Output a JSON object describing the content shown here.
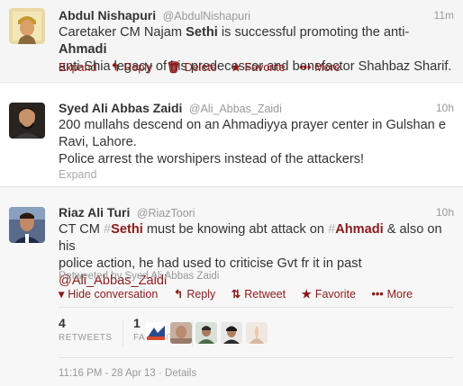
{
  "tweets": [
    {
      "fullname": "Abdul Nishapuri",
      "handle": "@AbdulNishapuri",
      "time": "11m",
      "text_a": "Caretaker CM Najam ",
      "text_kw1": "Sethi",
      "text_b": " is successful promoting the anti-",
      "text_kw2": "Ahmadi",
      "text_c": "anti-Shia legacy of his predecessor and benefactor Shahbaz Sharif.",
      "actions": {
        "expand": "Expand",
        "reply": "Reply",
        "delete": "Delete",
        "favorite": "Favorite",
        "more": "More"
      }
    },
    {
      "fullname": "Syed Ali Abbas Zaidi",
      "handle": "@Ali_Abbas_Zaidi",
      "time": "10h",
      "line1": "200 mullahs descend on an Ahmadiyya prayer center in Gulshan e",
      "line2": "Ravi, Lahore.",
      "line3": "Police arrest the worshipers instead of the attackers!",
      "actions": {
        "expand": "Expand"
      }
    },
    {
      "fullname": "Riaz Ali Turi",
      "handle": "@RiazToori",
      "time": "10h",
      "t_a": "CT CM ",
      "tag1_hash": "#",
      "tag1": "Sethi",
      "t_b": " must be knowing abt attack on ",
      "tag2_hash": "#",
      "tag2": "Ahmadi",
      "t_c": " & also on his",
      "line2": "police action, he had used to criticise Gvt fr it in past",
      "mention": "@Ali_Abbas_Zaidi",
      "retweeted_by": "Retweeted by Syed Ali Abbas Zaidi",
      "actions": {
        "hide": "Hide conversation",
        "reply": "Reply",
        "retweet": "Retweet",
        "favorite": "Favorite",
        "more": "More"
      },
      "stats": {
        "retweets": "4",
        "retweets_label": "RETWEETS",
        "favorites": "1",
        "favorites_label": "FAVORITE"
      },
      "footer": "11:16 PM - 28 Apr 13 · Details"
    }
  ],
  "colors": {
    "link": "#8a1a1a",
    "muted": "#999999",
    "highlight_bg": "#f5f5f5"
  },
  "icons": {
    "reply": "reply-arrow-icon",
    "delete": "trash-icon",
    "favorite": "star-icon",
    "more": "dots-icon",
    "retweet": "retweet-icon",
    "hide": "triangle-down-icon"
  }
}
